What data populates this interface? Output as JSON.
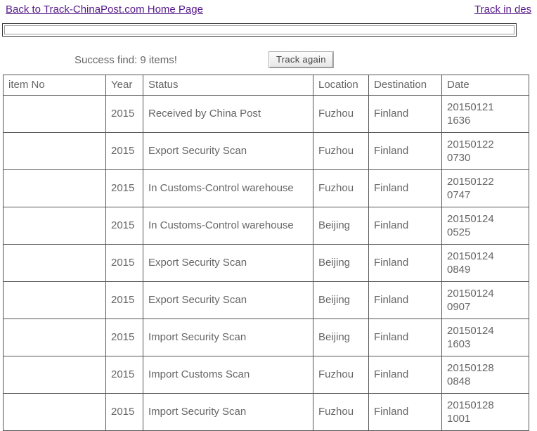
{
  "links": {
    "home": "Back to Track-ChinaPost.com Home Page",
    "destination": "Track in des"
  },
  "search": {
    "value": "",
    "placeholder": ""
  },
  "status": {
    "message": "Success find: 9 items!",
    "track_again_label": "Track again"
  },
  "table": {
    "columns": [
      "item No",
      "Year",
      "Status",
      "Location",
      "Destination",
      "Date"
    ],
    "rows": [
      {
        "item_no": "",
        "year": "2015",
        "status": "Received by China Post",
        "location": "Fuzhou",
        "destination": "Finland",
        "date": "20150121",
        "time": "1636"
      },
      {
        "item_no": "",
        "year": "2015",
        "status": "Export Security Scan",
        "location": "Fuzhou",
        "destination": "Finland",
        "date": "20150122",
        "time": "0730"
      },
      {
        "item_no": "",
        "year": "2015",
        "status": "In Customs-Control warehouse",
        "location": "Fuzhou",
        "destination": "Finland",
        "date": "20150122",
        "time": "0747"
      },
      {
        "item_no": "",
        "year": "2015",
        "status": "In Customs-Control warehouse",
        "location": "Beijing",
        "destination": "Finland",
        "date": "20150124",
        "time": "0525"
      },
      {
        "item_no": "",
        "year": "2015",
        "status": "Export Security Scan",
        "location": "Beijing",
        "destination": "Finland",
        "date": "20150124",
        "time": "0849"
      },
      {
        "item_no": "",
        "year": "2015",
        "status": "Export Security Scan",
        "location": "Beijing",
        "destination": "Finland",
        "date": "20150124",
        "time": "0907"
      },
      {
        "item_no": "",
        "year": "2015",
        "status": "Import Security Scan",
        "location": "Beijing",
        "destination": "Finland",
        "date": "20150124",
        "time": "1603"
      },
      {
        "item_no": "",
        "year": "2015",
        "status": "Import Customs Scan",
        "location": "Fuzhou",
        "destination": "Finland",
        "date": "20150128",
        "time": "0848"
      },
      {
        "item_no": "",
        "year": "2015",
        "status": "Import Security Scan",
        "location": "Fuzhou",
        "destination": "Finland",
        "date": "20150128",
        "time": "1001"
      }
    ]
  },
  "colors": {
    "link": "#551a8b",
    "text": "#666666",
    "border": "#555555"
  }
}
